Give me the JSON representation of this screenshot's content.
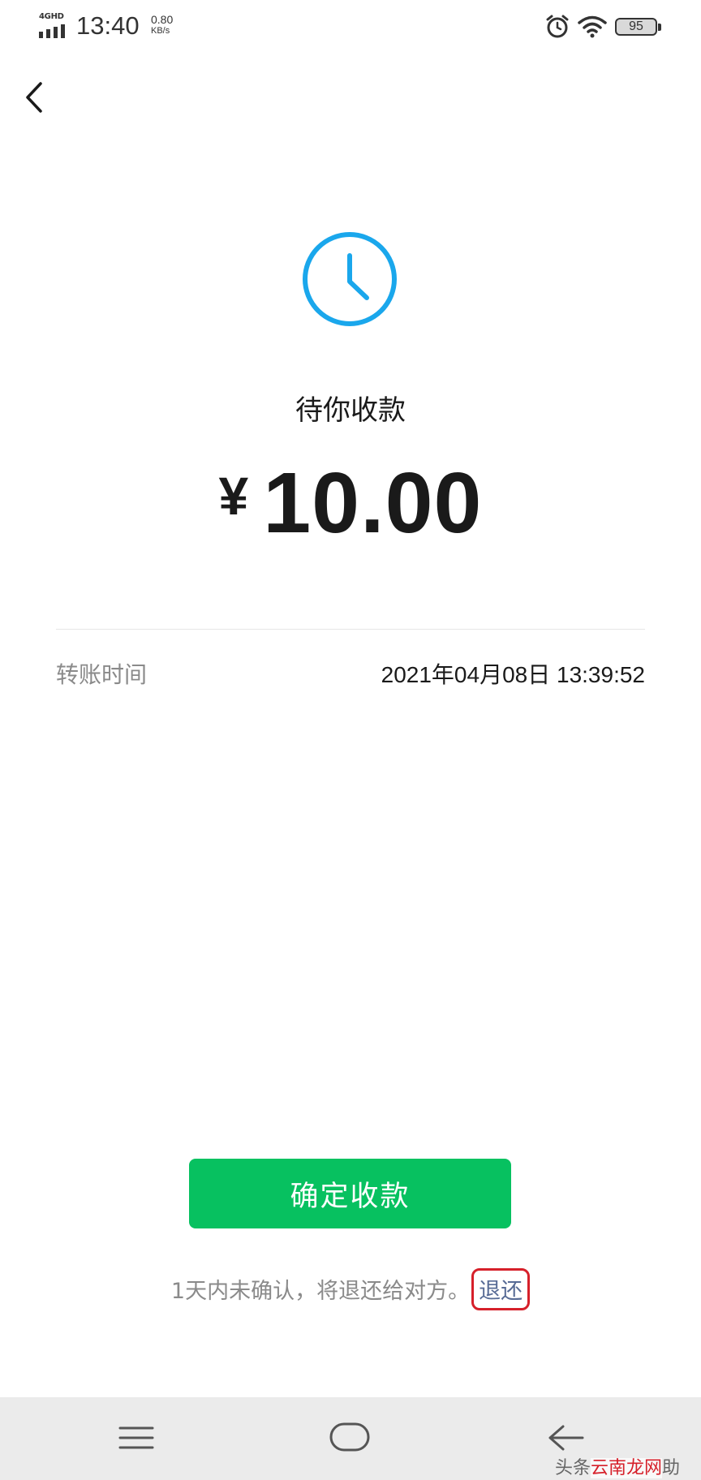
{
  "status_bar": {
    "network": "4GHD",
    "time": "13:40",
    "speed_value": "0.80",
    "speed_unit": "KB/s",
    "battery": "95",
    "icons": [
      "signal-icon",
      "alarm-icon",
      "wifi-icon",
      "battery-icon"
    ]
  },
  "nav": {
    "back_icon": "chevron-left-icon"
  },
  "main": {
    "status_icon": "clock-icon",
    "status_title": "待你收款",
    "currency": "¥",
    "amount": "10.00",
    "info": {
      "label": "转账时间",
      "value": "2021年04月08日 13:39:52"
    }
  },
  "actions": {
    "confirm_label": "确定收款",
    "note_text": "1天内未确认，将退还给对方。",
    "return_link": "退还"
  },
  "system_nav": {
    "icons": [
      "menu-icon",
      "home-icon",
      "back-arrow-icon"
    ]
  },
  "watermark": {
    "prefix": "头条",
    "accent": "云南龙网",
    "suffix": "助"
  },
  "colors": {
    "accent_green": "#07c160",
    "clock_blue": "#1aa7ec",
    "link_blue": "#576b95",
    "highlight_red": "#d6202a"
  }
}
